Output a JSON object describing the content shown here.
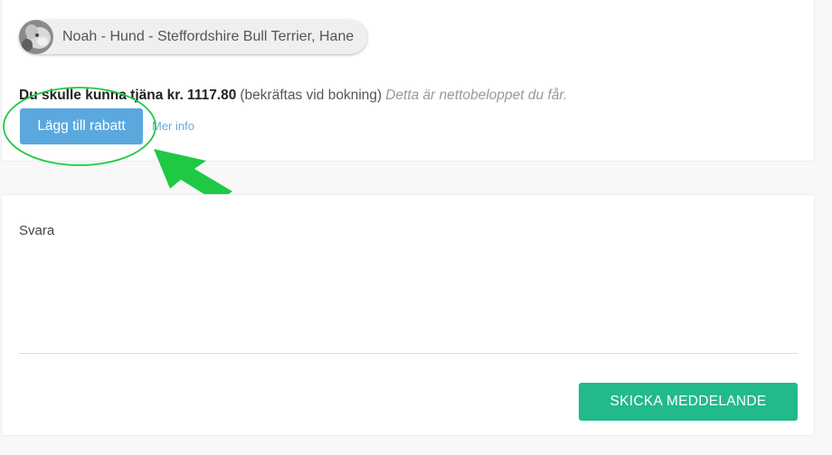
{
  "pet": {
    "label": "Noah - Hund - Steffordshire Bull Terrier, Hane",
    "avatar_icon": "dog-photo-avatar"
  },
  "earnings": {
    "bold_text": "Du skulle kunna tjäna kr. 1117.80",
    "note": "(bekräftas vid bokning)",
    "italic_note": "Detta är nettobeloppet du får."
  },
  "discount": {
    "button_label": "Lägg till rabatt",
    "more_info_link": "Mer info"
  },
  "annotation": {
    "color": "#1fc944",
    "ellipse": "highlight-ellipse",
    "arrow": "pointer-arrow"
  },
  "reply": {
    "label": "Svara",
    "textarea_value": "",
    "send_button_label": "SKICKA MEDDELANDE"
  },
  "colors": {
    "primary_button": "#5ba8de",
    "send_button": "#22b98d",
    "link": "#6fa9d8"
  }
}
